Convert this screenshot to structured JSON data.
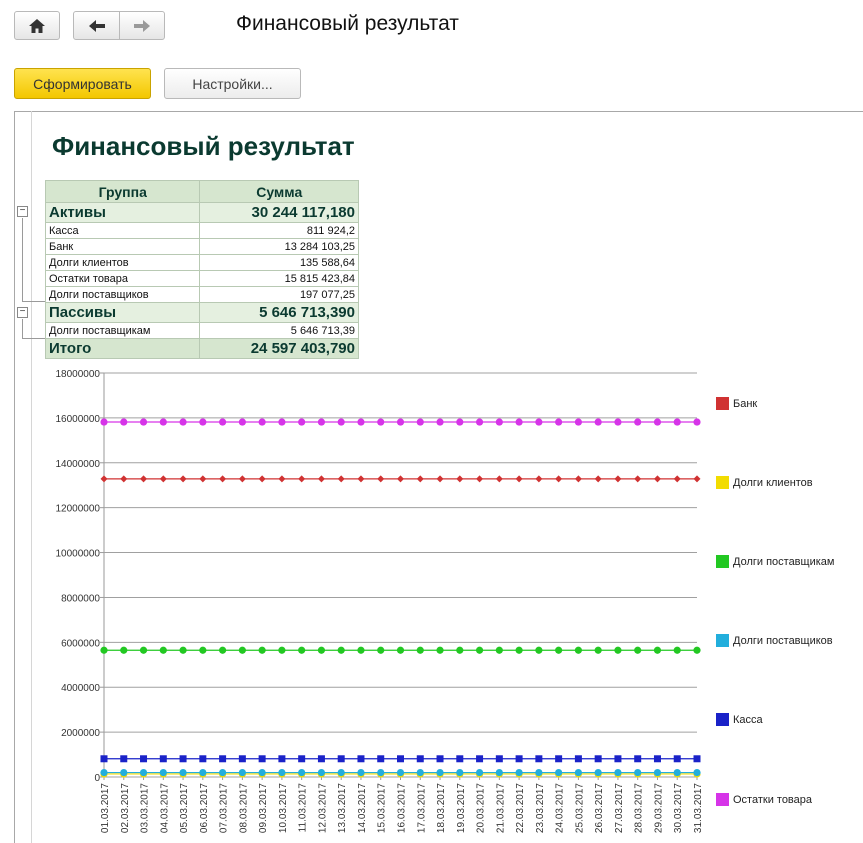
{
  "header": {
    "title": "Финансовый результат",
    "home_icon": "home-icon",
    "back_icon": "arrow-left-icon",
    "forward_icon": "arrow-right-icon"
  },
  "toolbar": {
    "generate_label": "Сформировать",
    "settings_label": "Настройки..."
  },
  "report": {
    "heading": "Финансовый результат",
    "table": {
      "columns": [
        "Группа",
        "Сумма"
      ],
      "groups": [
        {
          "name": "Активы",
          "total": "30 244 117,180",
          "rows": [
            {
              "name": "Касса",
              "value": "811 924,2"
            },
            {
              "name": "Банк",
              "value": "13 284 103,25"
            },
            {
              "name": "Долги клиентов",
              "value": "135 588,64"
            },
            {
              "name": "Остатки товара",
              "value": "15 815 423,84"
            },
            {
              "name": "Долги поставщиков",
              "value": "197 077,25"
            }
          ]
        },
        {
          "name": "Пассивы",
          "total": "5 646 713,390",
          "rows": [
            {
              "name": "Долги поставщикам",
              "value": "5 646 713,39"
            }
          ]
        }
      ],
      "total": {
        "name": "Итого",
        "value": "24 597 403,790"
      }
    }
  },
  "chart_data": {
    "type": "line",
    "x": [
      "01.03.2017",
      "02.03.2017",
      "03.03.2017",
      "04.03.2017",
      "05.03.2017",
      "06.03.2017",
      "07.03.2017",
      "08.03.2017",
      "09.03.2017",
      "10.03.2017",
      "11.03.2017",
      "12.03.2017",
      "13.03.2017",
      "14.03.2017",
      "15.03.2017",
      "16.03.2017",
      "17.03.2017",
      "18.03.2017",
      "19.03.2017",
      "20.03.2017",
      "21.03.2017",
      "22.03.2017",
      "23.03.2017",
      "24.03.2017",
      "25.03.2017",
      "26.03.2017",
      "27.03.2017",
      "28.03.2017",
      "29.03.2017",
      "30.03.2017",
      "31.03.2017"
    ],
    "y_ticks": [
      "0",
      "2000000",
      "4000000",
      "6000000",
      "8000000",
      "10000000",
      "12000000",
      "14000000",
      "16000000",
      "18000000"
    ],
    "ylim": [
      0,
      18000000
    ],
    "grid": true,
    "legend_position": "right",
    "series": [
      {
        "name": "Банк",
        "value": 13284103.25,
        "color": "#d03232",
        "marker": "diamond"
      },
      {
        "name": "Долги клиентов",
        "value": 135588.64,
        "color": "#f2dc00",
        "marker": "circle"
      },
      {
        "name": "Долги поставщикам",
        "value": 5646713.39,
        "color": "#22c822",
        "marker": "circle"
      },
      {
        "name": "Долги поставщиков",
        "value": 197077.25,
        "color": "#22aedc",
        "marker": "circle"
      },
      {
        "name": "Касса",
        "value": 811924.2,
        "color": "#1a22c8",
        "marker": "square"
      },
      {
        "name": "Остатки товара",
        "value": 15815423.84,
        "color": "#d634e8",
        "marker": "circle"
      }
    ]
  }
}
